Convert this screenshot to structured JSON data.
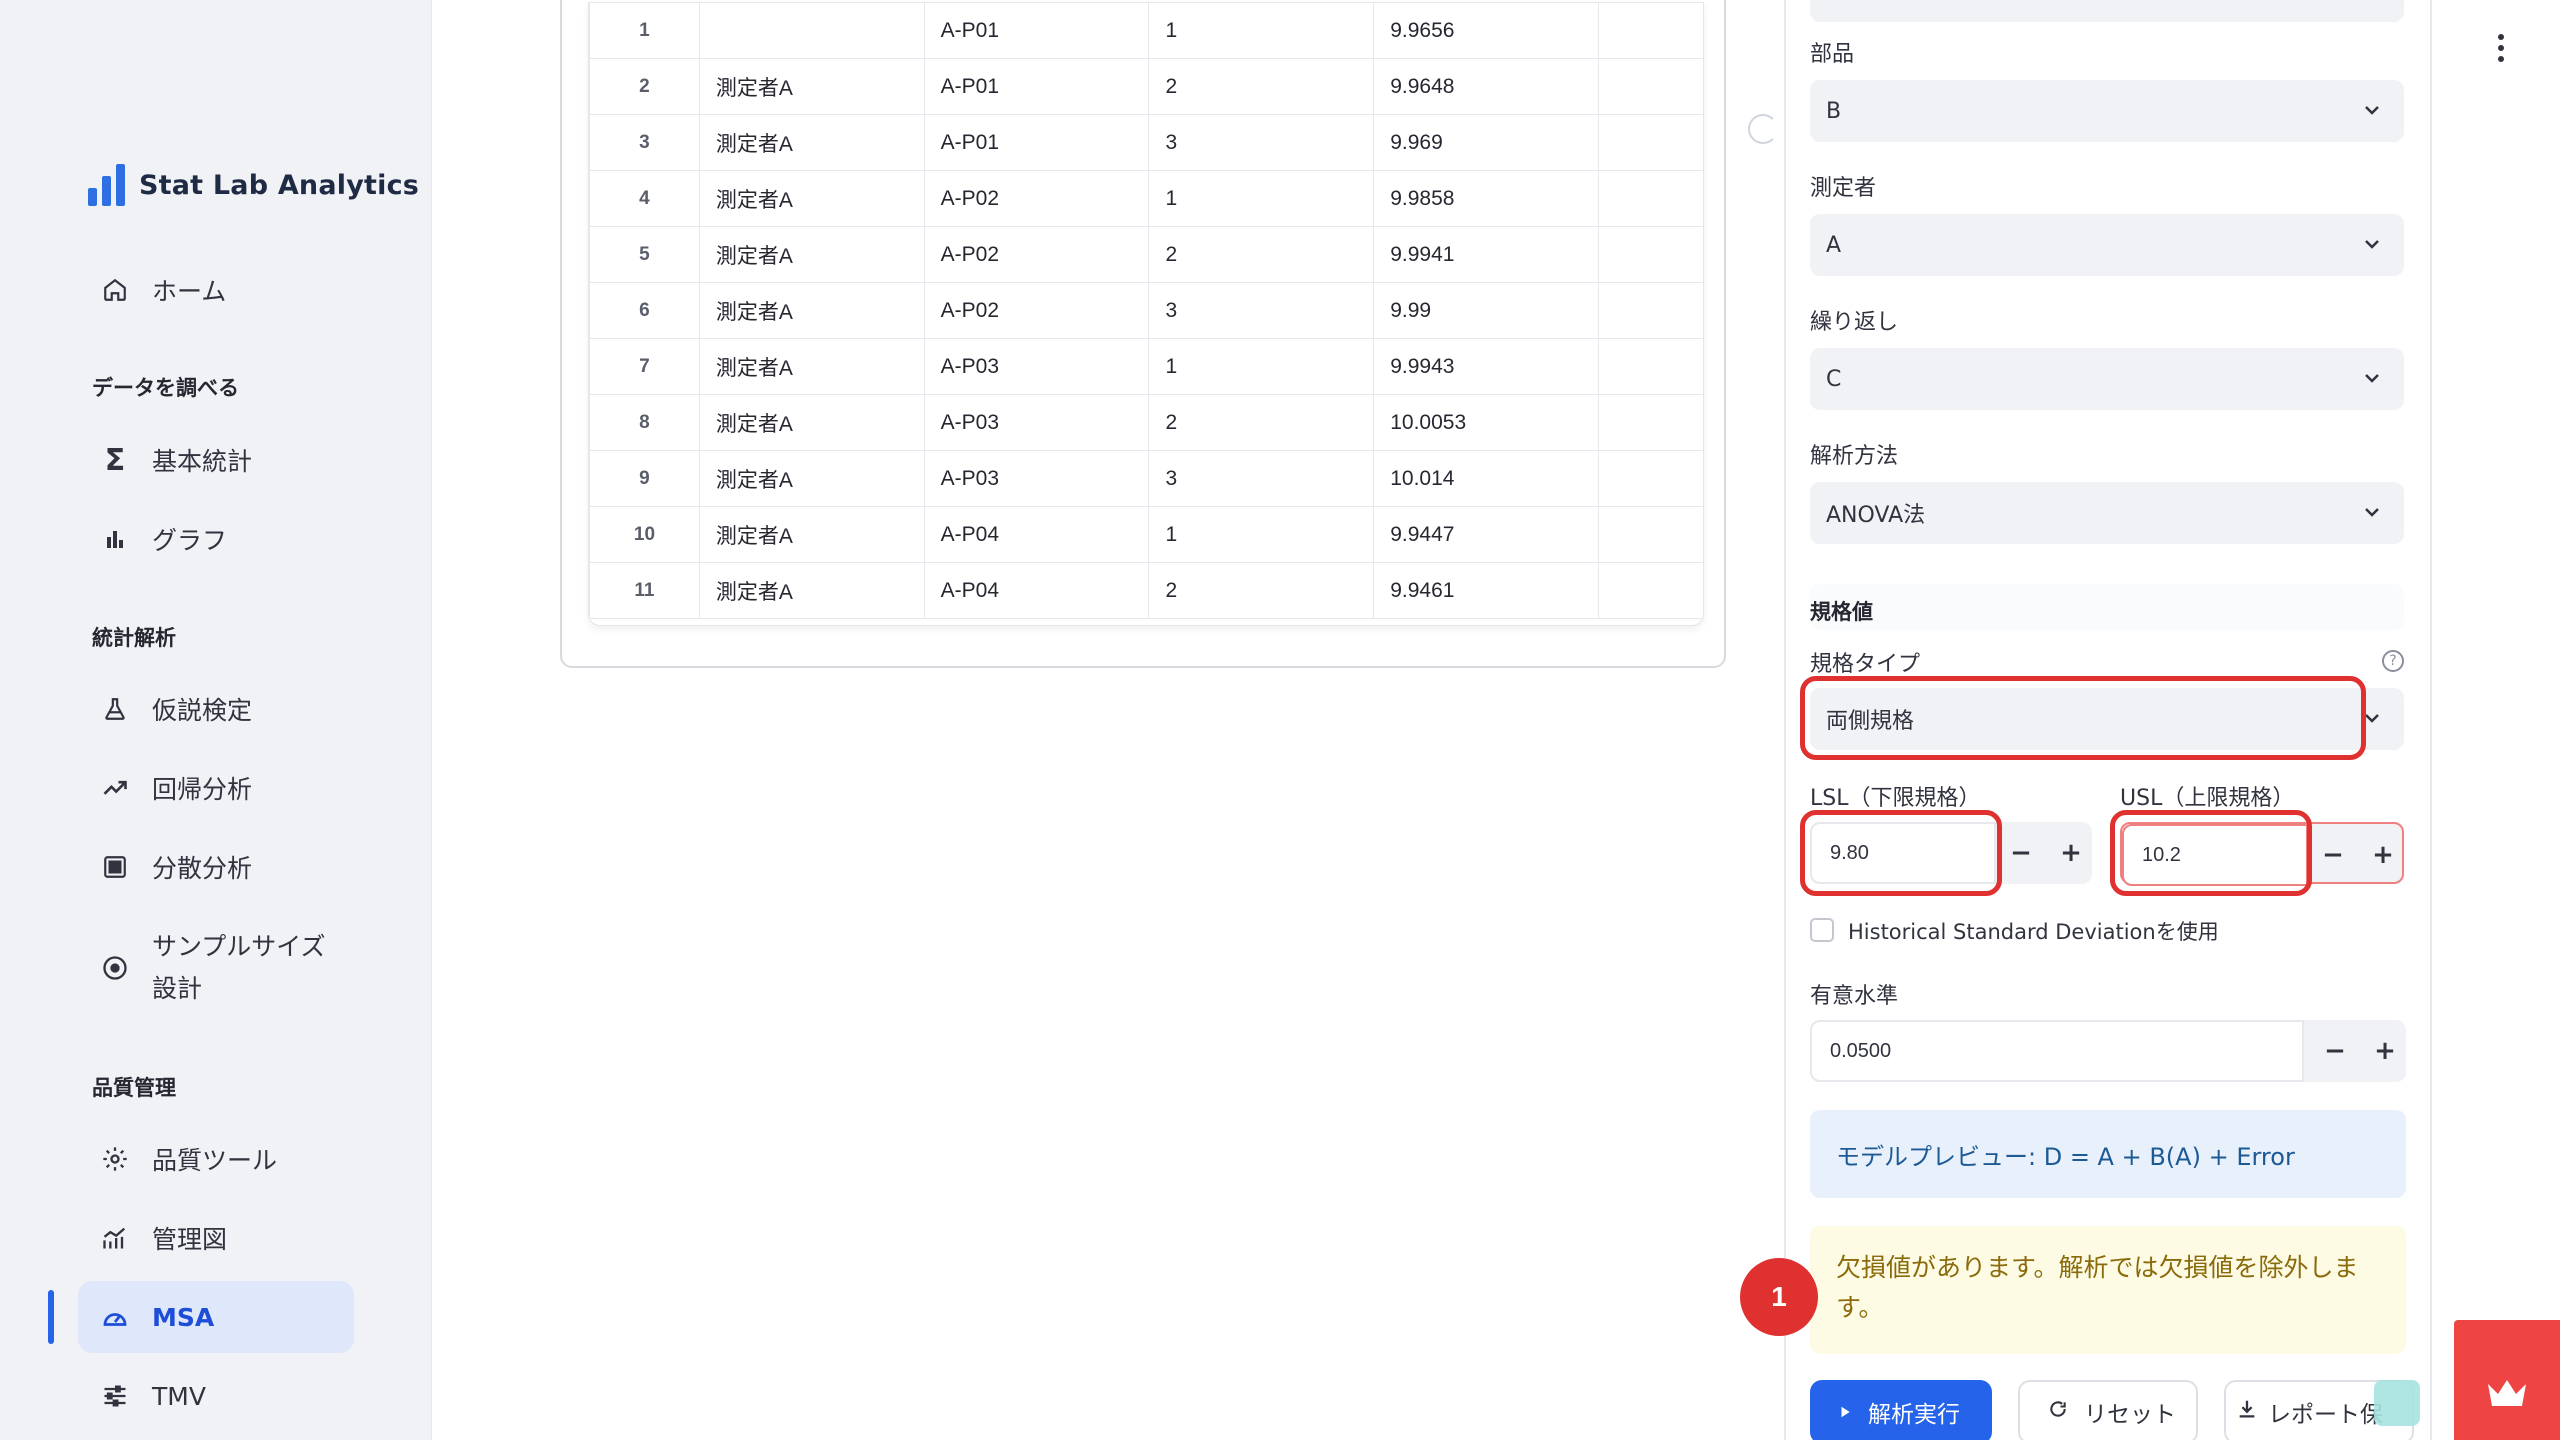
{
  "brand": {
    "name": "Stat Lab Analytics",
    "accent": "#2f6fe4"
  },
  "nav": {
    "home": "ホーム",
    "section_explore": "データを調べる",
    "basic_stats": "基本統計",
    "graph": "グラフ",
    "section_stats": "統計解析",
    "hypothesis": "仮説検定",
    "regression": "回帰分析",
    "anova": "分散分析",
    "sample_size_l1": "サンプルサイズ",
    "sample_size_l2": "設計",
    "section_quality": "品質管理",
    "quality_tools": "品質ツール",
    "control_chart": "管理図",
    "msa": "MSA",
    "tmv": "TMV"
  },
  "table": {
    "rows": [
      [
        "1",
        "",
        "A-P01",
        "1",
        "9.9656",
        ""
      ],
      [
        "2",
        "測定者A",
        "A-P01",
        "2",
        "9.9648",
        ""
      ],
      [
        "3",
        "測定者A",
        "A-P01",
        "3",
        "9.969",
        ""
      ],
      [
        "4",
        "測定者A",
        "A-P02",
        "1",
        "9.9858",
        ""
      ],
      [
        "5",
        "測定者A",
        "A-P02",
        "2",
        "9.9941",
        ""
      ],
      [
        "6",
        "測定者A",
        "A-P02",
        "3",
        "9.99",
        ""
      ],
      [
        "7",
        "測定者A",
        "A-P03",
        "1",
        "9.9943",
        ""
      ],
      [
        "8",
        "測定者A",
        "A-P03",
        "2",
        "10.0053",
        ""
      ],
      [
        "9",
        "測定者A",
        "A-P03",
        "3",
        "10.014",
        ""
      ],
      [
        "10",
        "測定者A",
        "A-P04",
        "1",
        "9.9447",
        ""
      ],
      [
        "11",
        "測定者A",
        "A-P04",
        "2",
        "9.9461",
        ""
      ]
    ]
  },
  "panel": {
    "part_label": "部品",
    "part_value": "B",
    "operator_label": "測定者",
    "operator_value": "A",
    "repeat_label": "繰り返し",
    "repeat_value": "C",
    "method_label": "解析方法",
    "method_value": "ANOVA法",
    "spec_heading": "規格値",
    "spec_type_label": "規格タイプ",
    "spec_type_value": "両側規格",
    "lsl_label": "LSL（下限規格）",
    "lsl_value": "9.80",
    "usl_label": "USL（上限規格）",
    "usl_value": "10.2",
    "hist_sd_label": "Historical Standard Deviationを使用",
    "alpha_label": "有意水準",
    "alpha_value": "0.0500",
    "model_preview": "モデルプレビュー: D = A + B(A) + Error",
    "missing_warning": "欠損値があります。解析では欠損値を除外します。",
    "badge": "1",
    "run_button": "解析実行",
    "reset_button": "リセット",
    "report_button": "レポート保",
    "minus": "−",
    "plus": "+"
  }
}
